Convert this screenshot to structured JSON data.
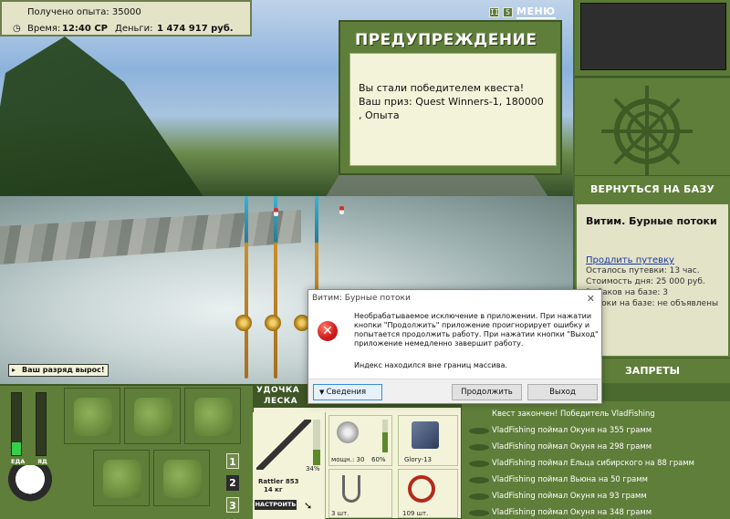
{
  "stats": {
    "experience_label": "Получено опыта:",
    "experience_value": "35000",
    "time_label": "Время:",
    "time_value": "12:40 СР",
    "money_label": "Деньги:",
    "money_value": "1 474 917 руб."
  },
  "top_icons": {
    "pause": "II",
    "sound": "S",
    "menu_label": "МЕНЮ"
  },
  "warning": {
    "title": "ПРЕДУПРЕЖДЕНИЕ",
    "message": "Вы стали победителем квеста! Ваш приз: Quest Winners-1, 180000 , Опыта"
  },
  "scene": {
    "rank_badge": "Ваш разряд вырос!"
  },
  "right_panel": {
    "back_to_base": "ВЕРНУТЬСЯ НА БАЗУ",
    "location_title": "Витим. Бурные потоки",
    "extend_link": "Продлить путевку",
    "lines": [
      "Осталось путевки: 13 час.",
      "Стоимость дня: 25 000 руб.",
      "Рыбаков на базе: 3",
      "Игроки на базе: не объявлены"
    ],
    "bans_label": "ЗАПРЕТЫ"
  },
  "log": [
    "Квест закончен! Победитель VladFishing",
    "VladFishing поймал Окуня на 355 грамм",
    "VladFishing поймал Окуня на 298 грамм",
    "VladFishing поймал Ельца сибирского на 88 грамм",
    "VladFishing поймал Вьюна на 50 грамм",
    "VladFishing поймал Окуня на 93 грамм",
    "VladFishing поймал Окуня на 348 грамм"
  ],
  "meters": {
    "food_label": "ЕДА",
    "poison_label": "ЯД",
    "food_level": 0.2,
    "poison_level": 0.0
  },
  "inventory": {
    "pages": [
      "1",
      "2",
      "3"
    ]
  },
  "tackle": {
    "tab_rod": "УДОЧКА",
    "tab_line": "ЛЕСКА",
    "rod_name": "Rattler 853",
    "rod_weight": "14 кг",
    "rod_percent": "34%",
    "setup_button": "НАСТРОИТЬ",
    "reel_label": "мощн.: 30",
    "reel_percent": "60%",
    "line_label": "Glory-13",
    "hooks_count": "3 шт.",
    "bait_count": "109 шт."
  },
  "dialog": {
    "title": "Витим: Бурные потоки",
    "message": "Необрабатываемое исключение в приложении. При нажатии кнопки \"Продолжить\" приложение проигнорирует ошибку и попытается продолжить работу. При нажатии кнопки \"Выход\" приложение немедленно завершит работу.",
    "detail": "Индекс находился вне границ массива.",
    "details_button": "Сведения",
    "continue_button": "Продолжить",
    "exit_button": "Выход"
  },
  "colors": {
    "panel_green": "#5f7e3a",
    "cream": "#f3f3d9",
    "dark_green": "#3f5626",
    "link_blue": "#1d3aa0",
    "error_red": "#d21e1e"
  }
}
